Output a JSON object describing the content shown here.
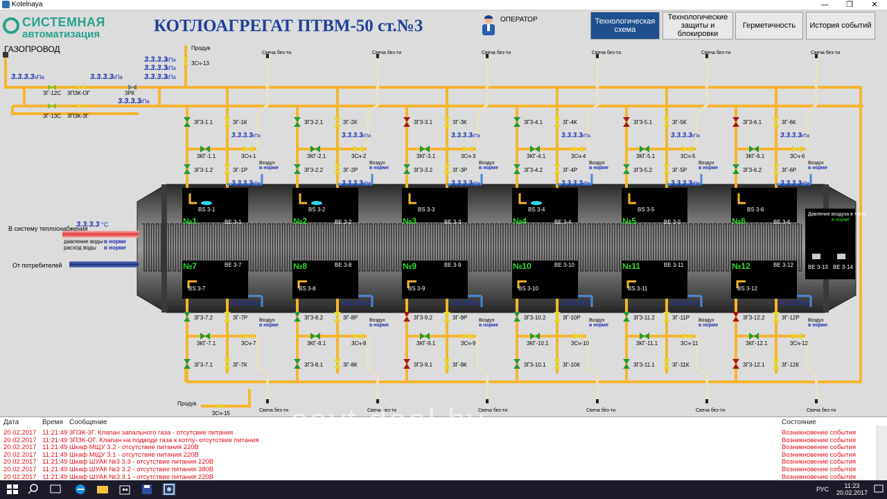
{
  "window": {
    "title": "Kotelnaya",
    "min": "—",
    "max": "❐",
    "close": "✕"
  },
  "header": {
    "logo_line1": "СИСТЕМНАЯ",
    "logo_line2": "автоматизация",
    "title": "КОТЛОАГРЕГАТ ПТВМ-50 ст.№3",
    "operator": "ОПЕРАТОР",
    "nav": [
      {
        "label": "Технологическая схема",
        "active": true
      },
      {
        "label": "Технологические защиты и блокировки",
        "active": false
      },
      {
        "label": "Герметичность",
        "active": false
      },
      {
        "label": "История событий",
        "active": false
      }
    ]
  },
  "scheme": {
    "gas_label": "ГАЗОПРОВОД",
    "gas_pressure": "3.3.3.3",
    "unit": "кПа",
    "unit_split": "кПа",
    "value": "3.3.3.3",
    "valves_top": [
      "3Г-12С",
      "3ПЗК-ОГ",
      "3РК",
      "3Г-13С",
      "3ПЗК-3Г",
      "3Сч-13"
    ],
    "purge": "Продув",
    "candle": "Свеча без-ти",
    "air": "Воздух",
    "in_norm": "в норме",
    "to_heat": "В систему теплоснабжения",
    "water_pressure": "давление воды",
    "water_flow": "расход воды",
    "from_consumers": "От потребителей",
    "temp_unit": "°С",
    "air_pressure_label": "Давление воздуха в топке",
    "be_extra": [
      "ВЕ 3-13",
      "ВЕ 3-14"
    ],
    "burners_top": [
      {
        "num": "№1",
        "bs": "BS 3-1",
        "be": "ВЕ 3-1",
        "v1": "3Г3-1.1",
        "v2": "3Г-1К",
        "v3": "3КГ-1.1",
        "v4": "3Сч-1",
        "v5": "3Г3-1.2",
        "v6": "3Г-1Р",
        "red": false,
        "flame": true
      },
      {
        "num": "№2",
        "bs": "BS 3-2",
        "be": "ВЕ 3-2",
        "v1": "3Г3-2.1",
        "v2": "3Г-2К",
        "v3": "3КГ-2.1",
        "v4": "3Сч-2",
        "v5": "3Г3-2.2",
        "v6": "3Г-2Р",
        "red": false,
        "flame": true
      },
      {
        "num": "№3",
        "bs": "BS 3-3",
        "be": "ВЕ 3-3",
        "v1": "3Г3-3.1",
        "v2": "3Г-3К",
        "v3": "3КГ-3.1",
        "v4": "3Сч-3",
        "v5": "3Г3-3.2",
        "v6": "3Г-3Р",
        "red": true,
        "flame": false
      },
      {
        "num": "№4",
        "bs": "BS 3-4",
        "be": "ВЕ 3-4",
        "v1": "3Г3-4.1",
        "v2": "3Г-4К",
        "v3": "3КГ-4.1",
        "v4": "3Сч-4",
        "v5": "3Г3-4.2",
        "v6": "3Г-4Р",
        "red": false,
        "flame": true
      },
      {
        "num": "№5",
        "bs": "BS 3-5",
        "be": "ВЕ 3-5",
        "v1": "3Г3-5.1",
        "v2": "3Г-5К",
        "v3": "3КГ-5.1",
        "v4": "3Сч-5",
        "v5": "3Г3-5.2",
        "v6": "3Г-5Р",
        "red": true,
        "flame": false
      },
      {
        "num": "№6",
        "bs": "BS 3-6",
        "be": "ВЕ 3-6",
        "v1": "3Г3-6.1",
        "v2": "3Г-6К",
        "v3": "3КГ-6.1",
        "v4": "3Сч-6",
        "v5": "3Г3-6.2",
        "v6": "3Г-6Р",
        "red": true,
        "flame": false
      }
    ],
    "burners_bottom": [
      {
        "num": "№7",
        "bs": "BS 3-7",
        "be": "ВЕ 3-7",
        "v1": "3Г3-7.2",
        "v2": "3Г-7Р",
        "v3": "3КГ-7.1",
        "v4": "3Сч-7",
        "v5": "3Г3-7.1",
        "v6": "3Г-7К",
        "red": false
      },
      {
        "num": "№8",
        "bs": "BS 3-8",
        "be": "ВЕ 3-8",
        "v1": "3Г3-8.2",
        "v2": "3Г-8Р",
        "v3": "3КГ-8.1",
        "v4": "3Сч-8",
        "v5": "3Г3-8.1",
        "v6": "3Г-8К",
        "red": false
      },
      {
        "num": "№9",
        "bs": "BS 3-9",
        "be": "ВЕ 3-9",
        "v1": "3Г3-9.2",
        "v2": "3Г-9Р",
        "v3": "3КГ-9.1",
        "v4": "3Сч-9",
        "v5": "3Г3-9.1",
        "v6": "3Г-9К",
        "red": true
      },
      {
        "num": "№10",
        "bs": "BS 3-10",
        "be": "ВЕ 3-10",
        "v1": "3Г3-10.2",
        "v2": "3Г-10Р",
        "v3": "3КГ-10.1",
        "v4": "3Сч-10",
        "v5": "3Г3-10.1",
        "v6": "3Г-10К",
        "red": false
      },
      {
        "num": "№11",
        "bs": "BS 3-11",
        "be": "ВЕ 3-11",
        "v1": "3Г3-11.2",
        "v2": "3Г-11Р",
        "v3": "3КГ-11.1",
        "v4": "3Сч-11",
        "v5": "3Г3-11.1",
        "v6": "3Г-11К",
        "red": false
      },
      {
        "num": "№12",
        "bs": "BS 3-12",
        "be": "ВЕ 3-12",
        "v1": "3Г3-12.2",
        "v2": "3Г-12Р",
        "v3": "3КГ-12.1",
        "v4": "3Сч-12",
        "v5": "3Г3-12.1",
        "v6": "3Г-12К",
        "red": true
      }
    ],
    "bottom_valve": "3Сч-15",
    "bottom_purge": "Продув"
  },
  "log": {
    "headers": [
      "Дата",
      "Время",
      "Сообщение",
      "Состояние"
    ],
    "rows": [
      [
        "20.02.2017",
        "11:21:49",
        "3ПЗК-3Г. Клапан запального газа - отсутсвие питания",
        "Возникновение события"
      ],
      [
        "20.02.2017",
        "11:21:49",
        "3ПЗК-ОГ. Клапан на подводе газа к котлу- отсутствие питания",
        "Возникновение события"
      ],
      [
        "20.02.2017",
        "11:21:49",
        "Шкаф МЩУ 3.2 - отсутствие питания 220В",
        "Возникновение события"
      ],
      [
        "20.02.2017",
        "11:21:49",
        "Шкаф МЩУ 3.1 - отсутствие питания 220В",
        "Возникновение события"
      ],
      [
        "20.02.2017",
        "11:21:49",
        "Шкаф ШУАК №3 3.3 - отсутствие питания 220В",
        "Возникновение события"
      ],
      [
        "20.02.2017",
        "11:21:49",
        "Шкаф ШУАК №3 3.2 - отсутствие питания 380В",
        "Возникновение события"
      ],
      [
        "20.02.2017",
        "11:21:49",
        "Шкаф ШУАК №3 3.1 - отсутствие питания 220В",
        "Возникновение события"
      ]
    ]
  },
  "watermark": "savt.deal.by",
  "taskbar": {
    "time": "11:23",
    "date": "20.02.2017",
    "lang": "РУС"
  }
}
